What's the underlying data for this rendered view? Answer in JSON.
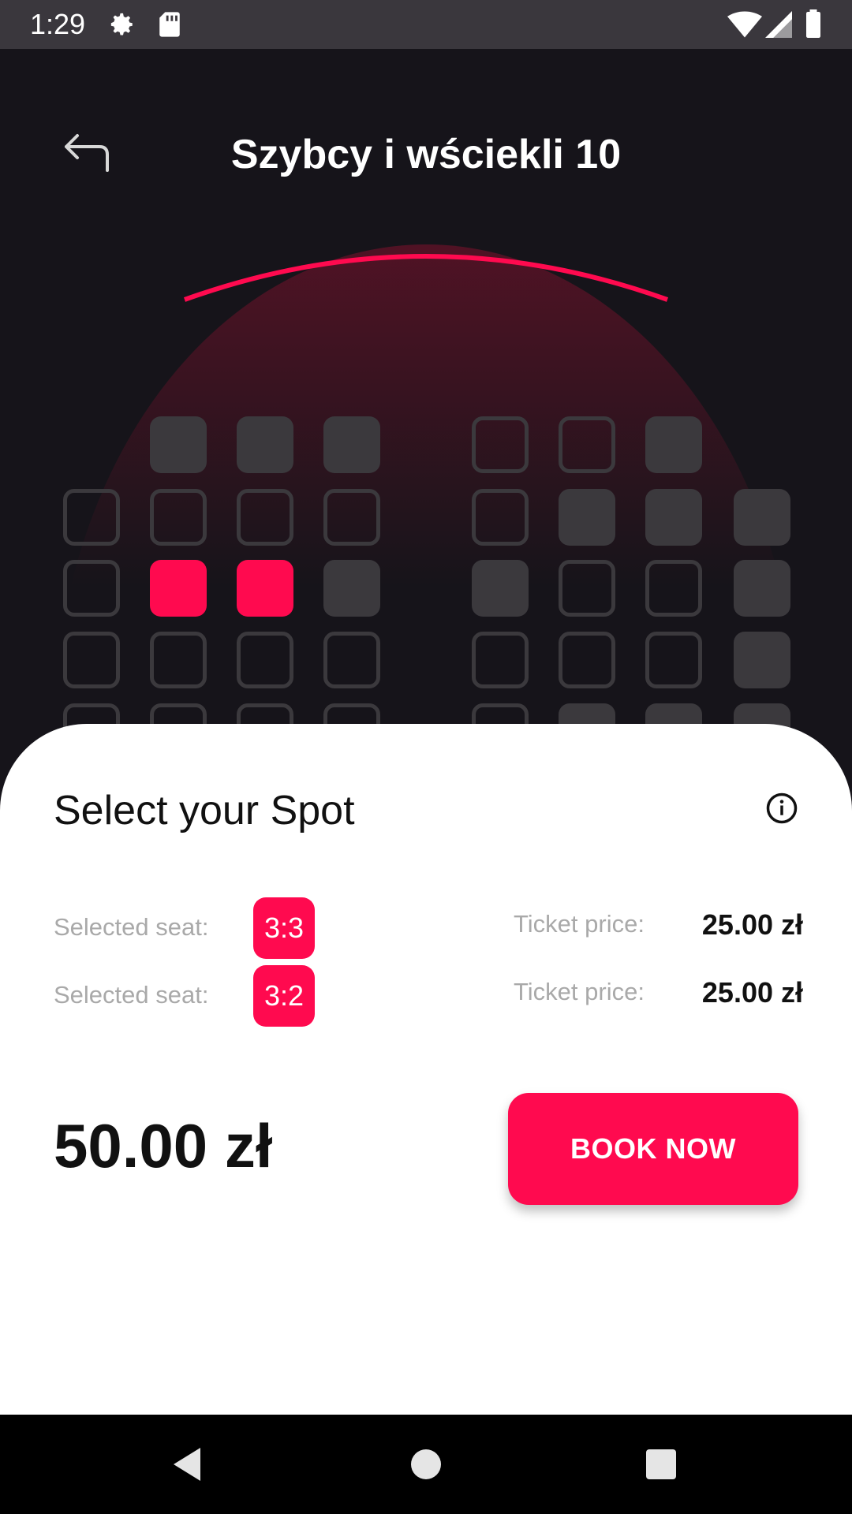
{
  "status_bar": {
    "time": "1:29"
  },
  "header": {
    "title": "Szybcy i wściekli 10",
    "back_icon": "back-arrow-icon"
  },
  "seating": {
    "legend_colors": {
      "free": "#3b393d",
      "taken": "#3b393d",
      "selected": "#ff0a4f"
    },
    "rows": [
      [
        "none",
        "taken",
        "taken",
        "taken",
        "none",
        "free",
        "free",
        "taken",
        "none"
      ],
      [
        "free",
        "free",
        "free",
        "free",
        "free",
        "taken",
        "taken",
        "taken"
      ],
      [
        "free",
        "selected",
        "selected",
        "taken",
        "taken",
        "free",
        "free",
        "taken"
      ],
      [
        "free",
        "free",
        "free",
        "free",
        "free",
        "free",
        "free",
        "taken"
      ],
      [
        "free",
        "free",
        "free",
        "free",
        "free",
        "taken",
        "taken",
        "taken"
      ]
    ]
  },
  "sheet": {
    "title": "Select your Spot",
    "info_icon": "info-icon",
    "selections": [
      {
        "seat_label": "Selected seat:",
        "seat": "3:3",
        "price_label": "Ticket price:",
        "price": "25.00 zł"
      },
      {
        "seat_label": "Selected seat:",
        "seat": "3:2",
        "price_label": "Ticket price:",
        "price": "25.00 zł"
      }
    ],
    "total": "50.00 zł",
    "book_button": "BOOK NOW"
  },
  "colors": {
    "accent": "#ff0a4f",
    "background": "#16141a"
  }
}
